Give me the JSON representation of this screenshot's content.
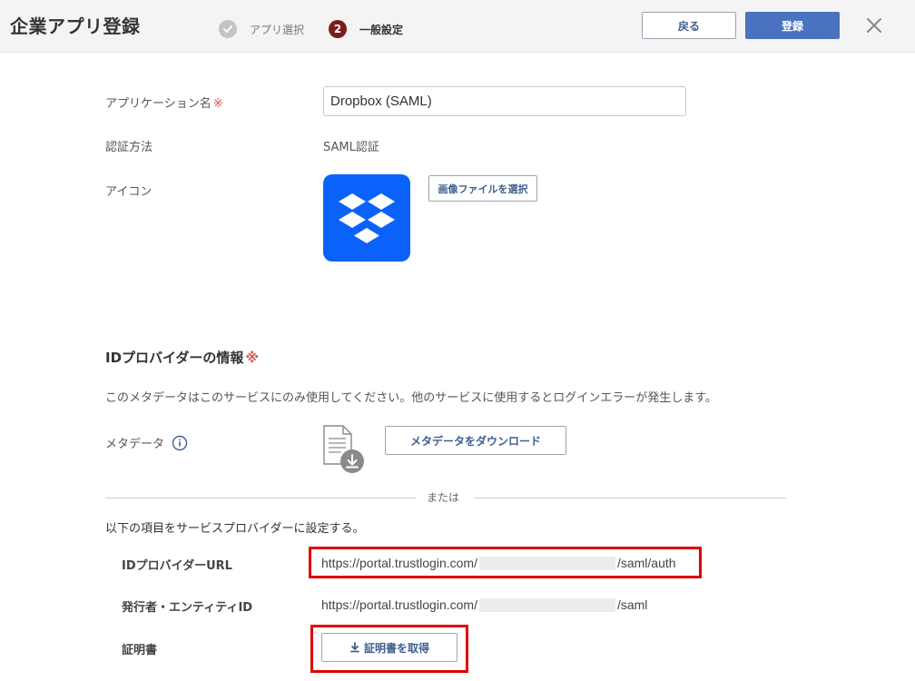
{
  "header": {
    "title": "企業アプリ登録",
    "steps": [
      {
        "label": "アプリ選択",
        "state": "completed"
      },
      {
        "number": "2",
        "label": "一般設定",
        "state": "active"
      }
    ],
    "back_label": "戻る",
    "register_label": "登録",
    "close_icon": "close-icon"
  },
  "form": {
    "app_name_label": "アプリケーション名",
    "required_mark": "※",
    "app_name_value": "Dropbox (SAML)",
    "auth_method_label": "認証方法",
    "auth_method_value": "SAML認証",
    "icon_label": "アイコン",
    "select_image_label": "画像ファイルを選択"
  },
  "idp": {
    "title": "IDプロバイダーの情報",
    "required_mark": "※",
    "description": "このメタデータはこのサービスにのみ使用してください。他のサービスに使用するとログインエラーが発生します。",
    "metadata_label": "メタデータ",
    "download_label": "メタデータをダウンロード",
    "or_text": "または",
    "sp_instruction": "以下の項目をサービスプロバイダーに設定する。",
    "fields": {
      "url_label": "IDプロバイダーURL",
      "url_prefix": "https://portal.trustlogin.com/",
      "url_suffix": "/saml/auth",
      "issuer_label": "発行者・エンティティID",
      "issuer_prefix": "https://portal.trustlogin.com/",
      "issuer_suffix": "/saml",
      "cert_label": "証明書",
      "cert_button_label": "証明書を取得"
    }
  },
  "colors": {
    "accent": "#4a72c0",
    "dropbox_blue": "#0a62fa",
    "highlight_red": "#e00000",
    "step_active": "#7a1d1d"
  }
}
